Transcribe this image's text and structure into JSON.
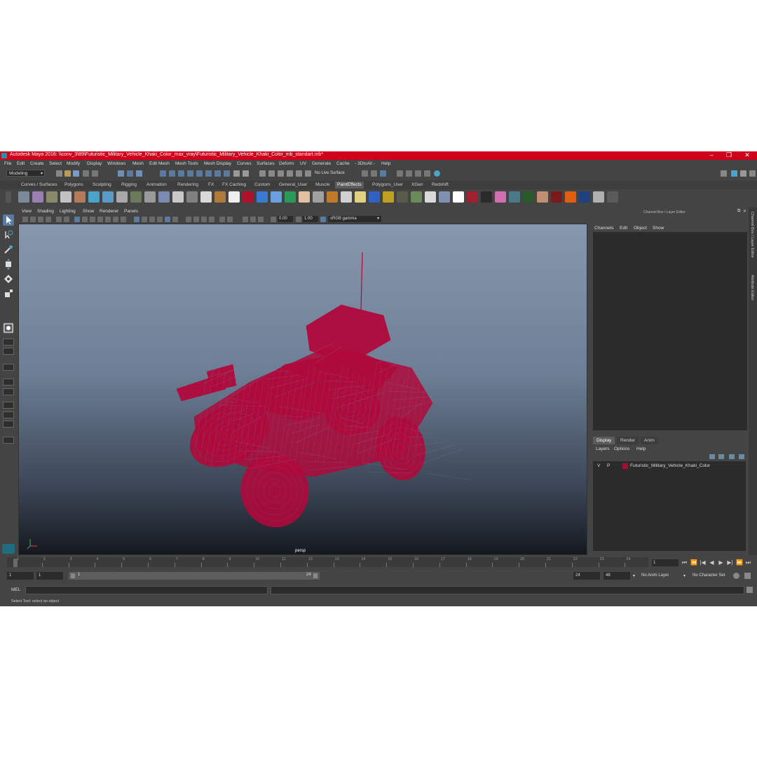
{
  "window": {
    "title": "Autodesk Maya 2016: \\\\conv_3\\89\\Futuristic_Military_Vehicle_Khaki_Color_max_vray\\Futuristic_Military_Vehicle_Khaki_Color_mb_standart.mb*",
    "minimize": "–",
    "maximize": "❐",
    "close": "✕"
  },
  "menubar": [
    "File",
    "Edit",
    "Create",
    "Select",
    "Modify",
    "Display",
    "Windows",
    "Mesh",
    "Edit Mesh",
    "Mesh Tools",
    "Mesh Display",
    "Curves",
    "Surfaces",
    "Deform",
    "UV",
    "Generate",
    "Cache",
    "- 3DtoAll -",
    "Help"
  ],
  "statusline": {
    "mode": "Modeling",
    "live_surface": "No Live Surface"
  },
  "shelf_tabs": [
    "Curves / Surfaces",
    "Polygons",
    "Sculpting",
    "Rigging",
    "Animation",
    "Rendering",
    "FX",
    "FX Caching",
    "Custom",
    "General_User",
    "Muscle",
    "PaintEffects",
    "Polygons_User",
    "XGen",
    "Redshift"
  ],
  "active_shelf_tab": "PaintEffects",
  "viewport": {
    "menu": [
      "View",
      "Shading",
      "Lighting",
      "Show",
      "Renderer",
      "Panels"
    ],
    "exposure": "0.00",
    "gamma": "1.00",
    "color_space": "sRGB gamma",
    "camera": "persp",
    "wire_color": "#b0093b"
  },
  "right_panel": {
    "title": "Channel Box / Layer Editor",
    "channel_menu": [
      "Channels",
      "Edit",
      "Object",
      "Show"
    ],
    "tabs": [
      "Display",
      "Render",
      "Anim"
    ],
    "active_tab": "Display",
    "layer_menu": [
      "Layers",
      "Options",
      "Help"
    ],
    "layers": [
      {
        "v": "V",
        "p": "P",
        "name": "Futuristic_Military_Vehicle_Khaki_Color",
        "color": "#a40e35"
      }
    ],
    "side_tabs": [
      "Channel Box / Layer Editor",
      "Attribute Editor"
    ]
  },
  "timeline": {
    "ticks": [
      "1",
      "2",
      "3",
      "4",
      "5",
      "6",
      "7",
      "8",
      "9",
      "10",
      "11",
      "12",
      "13",
      "14",
      "15",
      "16",
      "17",
      "18",
      "19",
      "20",
      "21",
      "22",
      "23",
      "24"
    ],
    "current_frame": "1"
  },
  "range": {
    "start": "1",
    "start2": "1",
    "range_start": "1",
    "range_end": "24",
    "end": "24",
    "end2": "48",
    "anim_layer": "No Anim Layer",
    "char_set": "No Character Set"
  },
  "command": {
    "label": "MEL"
  },
  "help_line": "Select Tool: select an object"
}
